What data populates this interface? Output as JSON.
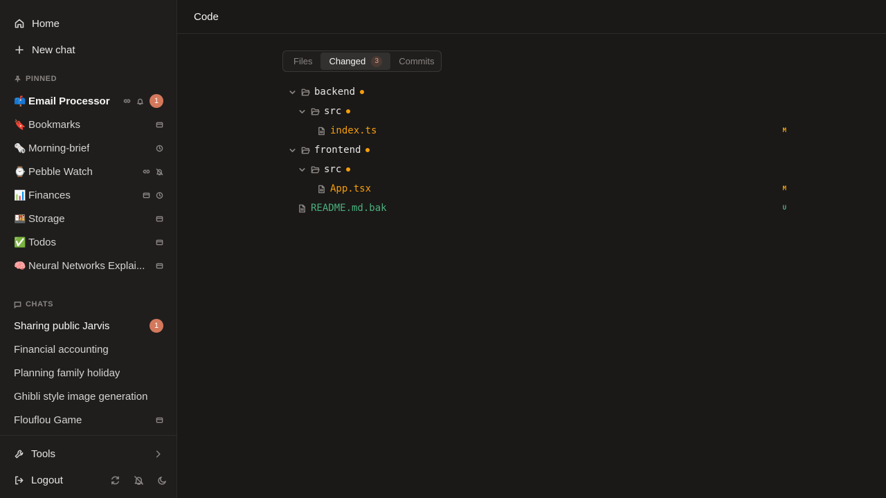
{
  "sidebar": {
    "home_label": "Home",
    "new_chat_label": "New chat",
    "pinned_label": "PINNED",
    "pinned": [
      {
        "emoji": "📫",
        "label": "Email Processor",
        "badge": "1"
      },
      {
        "emoji": "🔖",
        "label": "Bookmarks"
      },
      {
        "emoji": "🗞️",
        "label": "Morning-brief"
      },
      {
        "emoji": "⌚",
        "label": "Pebble Watch"
      },
      {
        "emoji": "📊",
        "label": "Finances"
      },
      {
        "emoji": "🍱",
        "label": "Storage"
      },
      {
        "emoji": "✅",
        "label": "Todos"
      },
      {
        "emoji": "🧠",
        "label": "Neural Networks Explai..."
      }
    ],
    "chats_label": "CHATS",
    "chats": [
      {
        "label": "Sharing public Jarvis",
        "badge": "1"
      },
      {
        "label": "Financial accounting"
      },
      {
        "label": "Planning family holiday"
      },
      {
        "label": "Ghibli style image generation"
      },
      {
        "label": "Flouflou Game"
      }
    ],
    "tools_label": "Tools",
    "logout_label": "Logout"
  },
  "header": {
    "title": "Code"
  },
  "tabs": {
    "files": "Files",
    "changed": "Changed",
    "changed_count": "3",
    "commits": "Commits"
  },
  "tree": [
    {
      "name": "backend",
      "type": "folder"
    },
    {
      "name": "src",
      "type": "folder"
    },
    {
      "name": "index.ts",
      "type": "file",
      "status": "M"
    },
    {
      "name": "frontend",
      "type": "folder"
    },
    {
      "name": "src",
      "type": "folder"
    },
    {
      "name": "App.tsx",
      "type": "file",
      "status": "M"
    },
    {
      "name": "README.md.bak",
      "type": "file",
      "status": "U"
    }
  ],
  "colors": {
    "modified": "#f59e0b",
    "untracked": "#4caf7d",
    "badge": "#d4785c"
  }
}
